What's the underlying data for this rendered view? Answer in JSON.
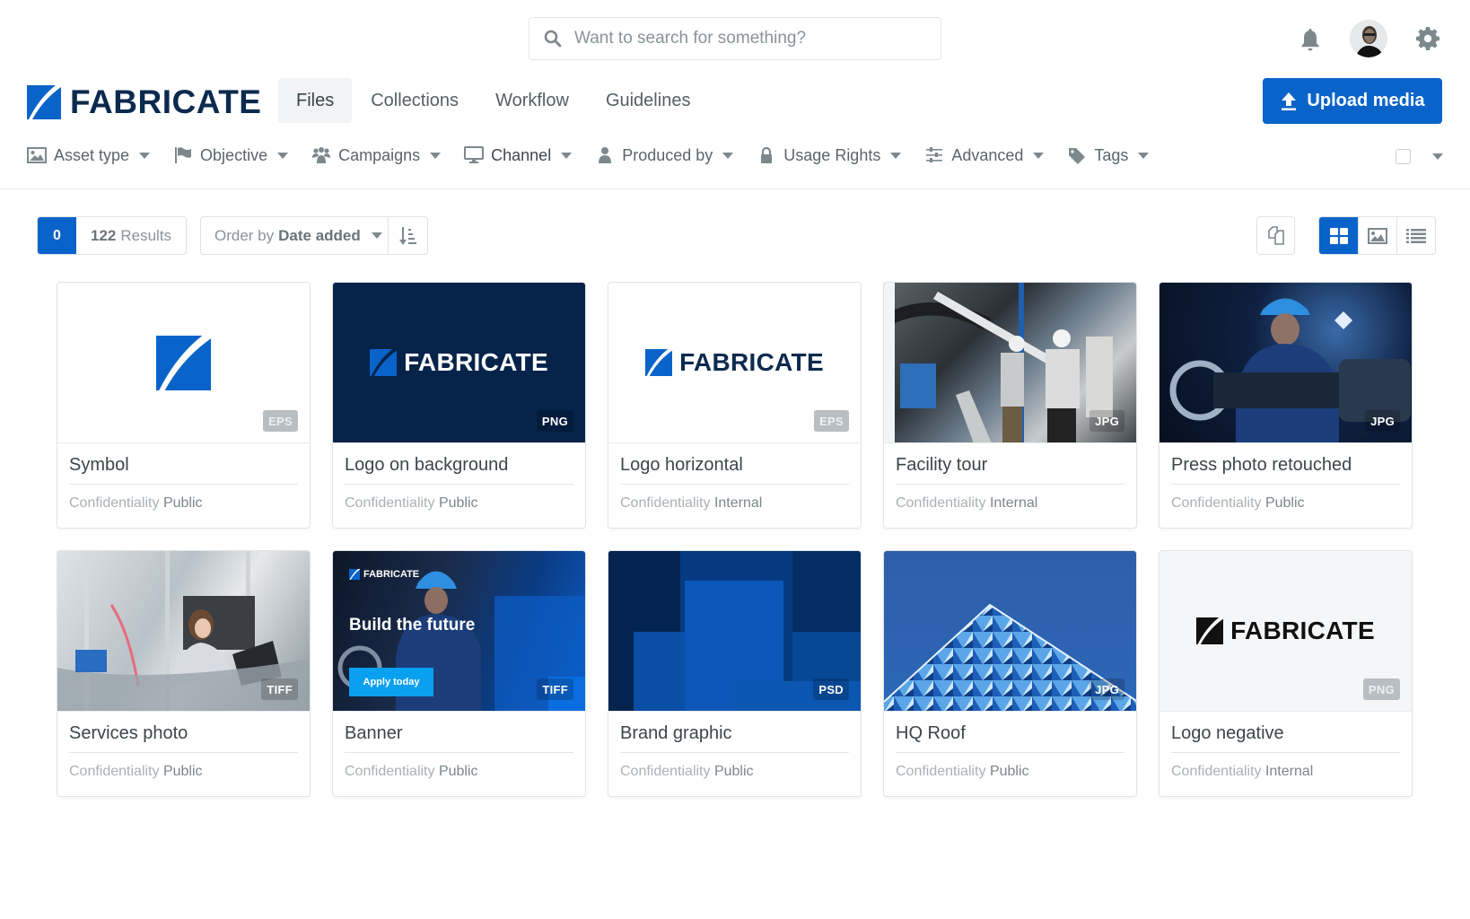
{
  "header": {
    "search_placeholder": "Want to search for something?",
    "icons": [
      "search-icon",
      "bell-icon",
      "avatar",
      "gear-icon"
    ]
  },
  "brand": {
    "name": "FABRICATE",
    "primary_color": "#0a63c9",
    "navy_color": "#0b2a4e"
  },
  "nav": {
    "items": [
      {
        "label": "Files",
        "active": true
      },
      {
        "label": "Collections",
        "active": false
      },
      {
        "label": "Workflow",
        "active": false
      },
      {
        "label": "Guidelines",
        "active": false
      }
    ],
    "upload_label": "Upload media"
  },
  "filters": [
    {
      "label": "Asset type",
      "icon": "image-icon"
    },
    {
      "label": "Objective",
      "icon": "flag-icon"
    },
    {
      "label": "Campaigns",
      "icon": "users-icon"
    },
    {
      "label": "Channel",
      "icon": "monitor-icon"
    },
    {
      "label": "Produced by",
      "icon": "user-icon"
    },
    {
      "label": "Usage Rights",
      "icon": "lock-icon"
    },
    {
      "label": "Advanced",
      "icon": "sliders-icon"
    },
    {
      "label": "Tags",
      "icon": "tag-icon"
    }
  ],
  "toolbar": {
    "selected_count": "0",
    "results_count": "122",
    "results_label": "Results",
    "order_prefix": "Order by",
    "order_value": "Date added",
    "view_modes": [
      "grid",
      "image",
      "list"
    ],
    "active_view": "grid"
  },
  "assets": [
    {
      "title": "Symbol",
      "type": "EPS",
      "conf_label": "Confidentiality",
      "conf_value": "Public"
    },
    {
      "title": "Logo on background",
      "type": "PNG",
      "conf_label": "Confidentiality",
      "conf_value": "Public"
    },
    {
      "title": "Logo horizontal",
      "type": "EPS",
      "conf_label": "Confidentiality",
      "conf_value": "Internal"
    },
    {
      "title": "Facility tour",
      "type": "JPG",
      "conf_label": "Confidentiality",
      "conf_value": "Internal"
    },
    {
      "title": "Press photo retouched",
      "type": "JPG",
      "conf_label": "Confidentiality",
      "conf_value": "Public"
    },
    {
      "title": "Services photo",
      "type": "TIFF",
      "conf_label": "Confidentiality",
      "conf_value": "Public"
    },
    {
      "title": "Banner",
      "type": "TIFF",
      "conf_label": "Confidentiality",
      "conf_value": "Public",
      "thumb_text": {
        "brand": "FABRICATE",
        "headline": "Build the future",
        "cta": "Apply today"
      }
    },
    {
      "title": "Brand graphic",
      "type": "PSD",
      "conf_label": "Confidentiality",
      "conf_value": "Public"
    },
    {
      "title": "HQ Roof",
      "type": "JPG",
      "conf_label": "Confidentiality",
      "conf_value": "Public"
    },
    {
      "title": "Logo negative",
      "type": "PNG",
      "conf_label": "Confidentiality",
      "conf_value": "Internal"
    }
  ]
}
